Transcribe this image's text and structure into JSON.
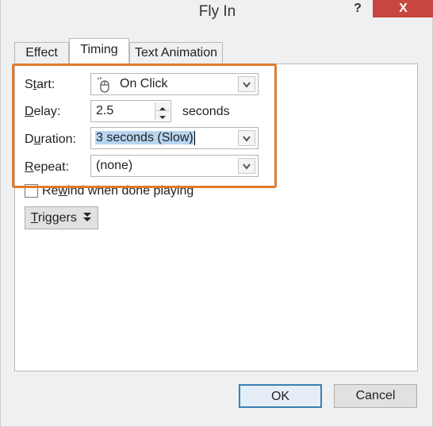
{
  "window": {
    "title": "Fly In",
    "help_label": "?",
    "close_label": "X"
  },
  "tabs": [
    {
      "label": "Effect"
    },
    {
      "label": "Timing"
    },
    {
      "label": "Text Animation"
    }
  ],
  "timing": {
    "start": {
      "label_pre": "S",
      "label_u": "t",
      "label_post": "art:",
      "value": "On Click",
      "icon": "mouse-icon"
    },
    "delay": {
      "label_pre": "",
      "label_u": "D",
      "label_post": "elay:",
      "value": "2.5",
      "unit": "seconds"
    },
    "duration": {
      "label_pre": "D",
      "label_u": "u",
      "label_post": "ration:",
      "value": "3 seconds (Slow)"
    },
    "repeat": {
      "label_pre": "",
      "label_u": "R",
      "label_post": "epeat:",
      "value": "(none)"
    },
    "rewind": {
      "label_pre": "Re",
      "label_u": "w",
      "label_post": "ind when done playing",
      "checked": false
    },
    "triggers": {
      "label_pre": "",
      "label_u": "T",
      "label_post": "riggers",
      "icon": "double-chevron-down-icon"
    }
  },
  "buttons": {
    "ok": "OK",
    "cancel": "Cancel"
  },
  "colors": {
    "highlight": "#e07b2c",
    "close": "#c7463f",
    "selection": "#b7d5f0"
  }
}
